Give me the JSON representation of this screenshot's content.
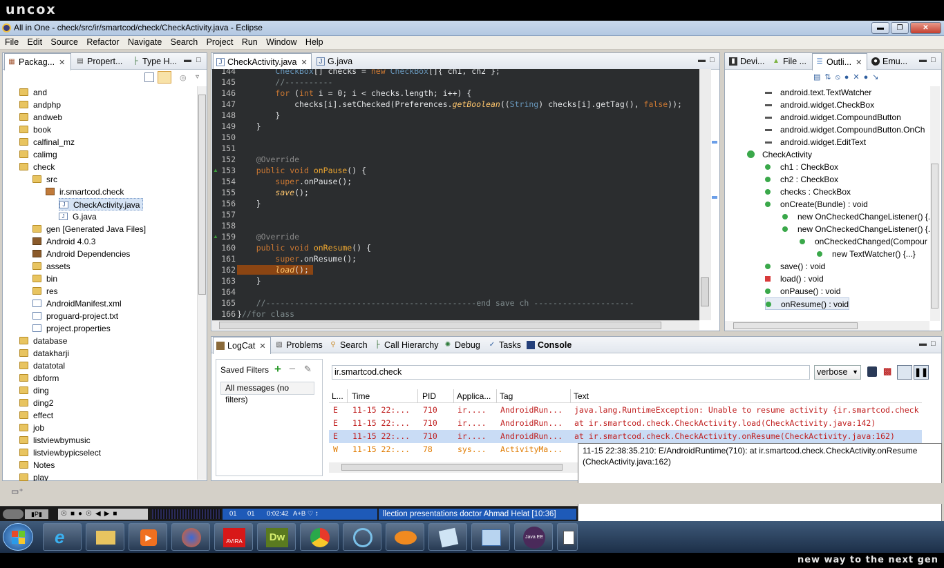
{
  "top_banner": {
    "logo": "uncox"
  },
  "window": {
    "title": "All in One - check/src/ir/smartcod/check/CheckActivity.java - Eclipse"
  },
  "menu": [
    "File",
    "Edit",
    "Source",
    "Refactor",
    "Navigate",
    "Search",
    "Project",
    "Run",
    "Window",
    "Help"
  ],
  "left_tabs": [
    {
      "label": "Packag...",
      "icon": "package-explorer-icon"
    },
    {
      "label": "Propert...",
      "icon": "properties-icon"
    },
    {
      "label": "Type H...",
      "icon": "type-hierarchy-icon"
    }
  ],
  "tree": [
    {
      "label": "and",
      "type": "folder"
    },
    {
      "label": "andphp",
      "type": "folder"
    },
    {
      "label": "andweb",
      "type": "folder"
    },
    {
      "label": "book",
      "type": "folder"
    },
    {
      "label": "calfinal_mz",
      "type": "folder"
    },
    {
      "label": "calimg",
      "type": "folder"
    },
    {
      "label": "check",
      "type": "folder"
    },
    {
      "label": "src",
      "type": "folder"
    },
    {
      "label": "ir.smartcod.check",
      "type": "package"
    },
    {
      "label": "CheckActivity.java",
      "type": "java"
    },
    {
      "label": "G.java",
      "type": "java"
    },
    {
      "label": "gen [Generated Java Files]",
      "type": "folder"
    },
    {
      "label": "Android 4.0.3",
      "type": "library"
    },
    {
      "label": "Android Dependencies",
      "type": "library"
    },
    {
      "label": "assets",
      "type": "folder"
    },
    {
      "label": "bin",
      "type": "folder"
    },
    {
      "label": "res",
      "type": "folder"
    },
    {
      "label": "AndroidManifest.xml",
      "type": "xml"
    },
    {
      "label": "proguard-project.txt",
      "type": "file"
    },
    {
      "label": "project.properties",
      "type": "file"
    },
    {
      "label": "database",
      "type": "folder"
    },
    {
      "label": "datakharji",
      "type": "folder"
    },
    {
      "label": "datatotal",
      "type": "folder"
    },
    {
      "label": "dbform",
      "type": "folder"
    },
    {
      "label": "ding",
      "type": "folder"
    },
    {
      "label": "ding2",
      "type": "folder"
    },
    {
      "label": "effect",
      "type": "folder"
    },
    {
      "label": "job",
      "type": "folder"
    },
    {
      "label": "listviewbymusic",
      "type": "folder"
    },
    {
      "label": "listviewbypicselect",
      "type": "folder"
    },
    {
      "label": "Notes",
      "type": "folder"
    },
    {
      "label": "play",
      "type": "folder"
    }
  ],
  "editor_tabs": [
    {
      "label": "CheckActivity.java",
      "active": true
    },
    {
      "label": "G.java",
      "active": false
    }
  ],
  "code_lines": [
    {
      "n": "144",
      "code": "        CheckBox[] checks = new CheckBox[]{ ch1, ch2 };"
    },
    {
      "n": "145",
      "code": "        //----------"
    },
    {
      "n": "146",
      "code": "        for (int i = 0; i < checks.length; i++) {"
    },
    {
      "n": "147",
      "code": "            checks[i].setChecked(Preferences.getBoolean((String) checks[i].getTag(), false));"
    },
    {
      "n": "148",
      "code": "        }"
    },
    {
      "n": "149",
      "code": "    }"
    },
    {
      "n": "150",
      "code": ""
    },
    {
      "n": "151",
      "code": ""
    },
    {
      "n": "152",
      "code": "    @Override"
    },
    {
      "n": "153",
      "code": "    public void onPause() {"
    },
    {
      "n": "154",
      "code": "        super.onPause();"
    },
    {
      "n": "155",
      "code": "        save();"
    },
    {
      "n": "156",
      "code": "    }"
    },
    {
      "n": "157",
      "code": ""
    },
    {
      "n": "158",
      "code": ""
    },
    {
      "n": "159",
      "code": "    @Override"
    },
    {
      "n": "160",
      "code": "    public void onResume() {"
    },
    {
      "n": "161",
      "code": "        super.onResume();"
    },
    {
      "n": "162",
      "code": "        load();"
    },
    {
      "n": "163",
      "code": "    }"
    },
    {
      "n": "164",
      "code": ""
    },
    {
      "n": "165",
      "code": "    //--------------------------------------------end save ch ---------------------"
    },
    {
      "n": "166",
      "code": "}//for class"
    }
  ],
  "right_tabs": [
    {
      "label": "Devi..."
    },
    {
      "label": "File ..."
    },
    {
      "label": "Outli..."
    },
    {
      "label": "Emu..."
    }
  ],
  "outline": [
    {
      "label": "android.text.TextWatcher",
      "indent": 1
    },
    {
      "label": "android.widget.CheckBox",
      "indent": 1
    },
    {
      "label": "android.widget.CompoundButton",
      "indent": 1
    },
    {
      "label": "android.widget.CompoundButton.OnCh",
      "indent": 1
    },
    {
      "label": "android.widget.EditText",
      "indent": 1
    },
    {
      "label": "CheckActivity",
      "indent": 0
    },
    {
      "label": "ch1 : CheckBox",
      "indent": 1
    },
    {
      "label": "ch2 : CheckBox",
      "indent": 1
    },
    {
      "label": "checks : CheckBox",
      "indent": 1
    },
    {
      "label": "onCreate(Bundle) : void",
      "indent": 1
    },
    {
      "label": "new OnCheckedChangeListener() {...",
      "indent": 2
    },
    {
      "label": "new OnCheckedChangeListener() {...",
      "indent": 2
    },
    {
      "label": "onCheckedChanged(Compour",
      "indent": 3
    },
    {
      "label": "new TextWatcher() {...}",
      "indent": 4
    },
    {
      "label": "save() : void",
      "indent": 1
    },
    {
      "label": "load() : void",
      "indent": 1
    },
    {
      "label": "onPause() : void",
      "indent": 1
    },
    {
      "label": "onResume() : void",
      "indent": 1
    }
  ],
  "bottom_tabs": [
    {
      "label": "LogCat",
      "active": true
    },
    {
      "label": "Problems"
    },
    {
      "label": "Search"
    },
    {
      "label": "Call Hierarchy"
    },
    {
      "label": "Debug"
    },
    {
      "label": "Tasks"
    },
    {
      "label": "Console"
    }
  ],
  "logcat": {
    "saved_filters_label": "Saved Filters",
    "filter_all": "All messages (no filters)",
    "search_value": "ir.smartcod.check",
    "level_select": "verbose",
    "columns": [
      "L...",
      "Time",
      "PID",
      "Applica...",
      "Tag",
      "Text"
    ],
    "rows": [
      {
        "level": "E",
        "time": "11-15 22:...",
        "pid": "710",
        "app": "ir....",
        "tag": "AndroidRun...",
        "text": "java.lang.RuntimeException: Unable to resume activity {ir.smartcod.check"
      },
      {
        "level": "E",
        "time": "11-15 22:...",
        "pid": "710",
        "app": "ir....",
        "tag": "AndroidRun...",
        "text": "at ir.smartcod.check.CheckActivity.load(CheckActivity.java:142)"
      },
      {
        "level": "E",
        "time": "11-15 22:...",
        "pid": "710",
        "app": "ir....",
        "tag": "AndroidRun...",
        "text": "at ir.smartcod.check.CheckActivity.onResume(CheckActivity.java:162)"
      },
      {
        "level": "W",
        "time": "11-15 22:...",
        "pid": "78",
        "app": "sys...",
        "tag": "ActivityMa...",
        "text": ""
      }
    ],
    "tooltip": "11-15 22:38:35.210: E/AndroidRuntime(710):        at ir.smartcod.check.CheckActivity.onResume (CheckActivity.java:162)"
  },
  "media_bar": {
    "time1": "01",
    "time2": "01",
    "elapsed": "0:02:42",
    "title": "llection presentations doctor Ahmad Helat  [10:36]"
  },
  "bottom_banner": {
    "slogan": "new way to the next gen"
  },
  "taskbar_apps": [
    "start",
    "internet-explorer",
    "file-explorer",
    "media-player",
    "firefox",
    "avira",
    "dreamweaver",
    "chrome",
    "security",
    "app",
    "notes",
    "control-panel",
    "java-ee-ide",
    "window"
  ]
}
